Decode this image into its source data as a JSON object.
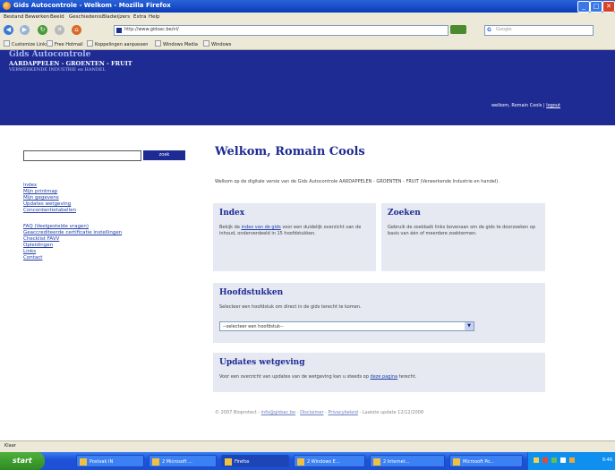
{
  "window": {
    "title": "Gids Autocontrole - Welkom - Mozilla Firefox"
  },
  "menu": [
    "Bestand",
    "Bewerken",
    "Beeld",
    "Geschiedenis",
    "Bladwijzers",
    "Extra",
    "Help"
  ],
  "nav": {
    "url": "http://www.gidsac.be/nl/",
    "search_placeholder": "Google"
  },
  "bookmarks": [
    "Customize Links",
    "Free Hotmail",
    "Koppelingen aanpassen",
    "Windows Media",
    "Windows"
  ],
  "header": {
    "logo_top": "Gids Autocontrole",
    "logo_main": "AARDAPPELEN - GROENTEN - FRUIT",
    "logo_sub": "VERWERKENDE INDUSTRIE en HANDEL",
    "welcome_prefix": "welkom, Romain Cools | ",
    "logout": "logout"
  },
  "sidebar": {
    "search_value": "",
    "search_button": "zoek",
    "links": [
      "Index",
      "Mijn printmap",
      "Mijn gegevens",
      "Updates wetgeving",
      "Concordantietabellen"
    ],
    "links2": [
      "FAQ (Veelgestelde vragen)",
      "Geaccrediteerde certificatie instellingen",
      "Checklist FAVV",
      "Opleidingen",
      "Links",
      "Contact"
    ]
  },
  "main": {
    "title": "Welkom, Romain Cools",
    "intro": "Welkom op de digitale versie van de Gids Autocontrole AARDAPPELEN - GROENTEN - FRUIT (Verwerkende Industrie en handel).",
    "index": {
      "title": "Index",
      "text_before": "Bekijk de ",
      "link": "index van de gids",
      "text_after": " voor een duidelijk overzicht van de inhoud, onderverdeeld in 15 hoofdstukken."
    },
    "zoeken": {
      "title": "Zoeken",
      "text": "Gebruik de zoekbalk links bovenaan om de gids te doorzoeken op basis van één of meerdere zoektermen."
    },
    "hoofdstukken": {
      "title": "Hoofdstukken",
      "text": "Selecteer een hoofdstuk om direct in de gids terecht te komen.",
      "select_value": "--selecteer een hoofdstuk--"
    },
    "updates": {
      "title": "Updates wetgeving",
      "text_before": "Voor een overzicht van updates van de wetgeving kan u steeds op ",
      "link": "deze pagina",
      "text_after": " terecht."
    },
    "footer": {
      "copyright": "© 2007 Bioprotect - ",
      "link1": "info@gidsac.be",
      "sep1": " - ",
      "link2": "Disclaimer",
      "sep2": " - ",
      "link3": "Privacybeleid",
      "rest": " - Laatste update 12/12/2008"
    }
  },
  "statusbar": "Klaar",
  "taskbar": {
    "start": "start",
    "tasks": [
      "Postvak IN",
      "2 Microsoft ...",
      "Firefox",
      "2 Windows E...",
      "2 Internet...",
      "Microsoft Po..."
    ],
    "clock": "9:46"
  }
}
